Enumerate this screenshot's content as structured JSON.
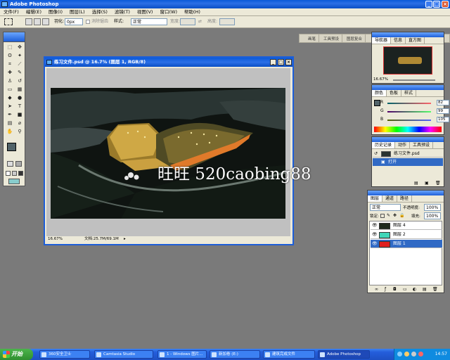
{
  "app": {
    "title": "Adobe Photoshop"
  },
  "menu": [
    "文件(F)",
    "编辑(E)",
    "图像(I)",
    "图层(L)",
    "选择(S)",
    "滤镜(T)",
    "视图(V)",
    "窗口(W)",
    "帮助(H)"
  ],
  "options": {
    "feather_label": "羽化:",
    "feather_value": "0px",
    "antialias_label": "消除锯齿",
    "style_label": "样式:",
    "style_value": "正常",
    "width_label": "宽度:",
    "height_label": "高度:"
  },
  "palette_well": [
    "画笔",
    "工具预设",
    "图层复合"
  ],
  "document": {
    "title": "练习文件.psd @ 16.7% (图层 1, RGB/8)",
    "zoom": "16.67%",
    "doc_info": "文档:25.7M/69.1M"
  },
  "navigator": {
    "tabs": [
      "导航器",
      "信息",
      "直方图"
    ],
    "zoom": "16.67%"
  },
  "color_panel": {
    "tabs": [
      "颜色",
      "色板",
      "样式"
    ],
    "r_label": "R",
    "r_value": "82",
    "g_label": "G",
    "g_value": "99",
    "b_label": "B",
    "b_value": "105"
  },
  "history": {
    "tabs": [
      "历史记录",
      "动作",
      "工具预设"
    ],
    "items": [
      "练习文件.psd",
      "打开"
    ]
  },
  "layers": {
    "tabs": [
      "图层",
      "通道",
      "路径"
    ],
    "blend_mode": "正常",
    "opacity_label": "不透明度:",
    "opacity": "100%",
    "lock_label": "锁定:",
    "fill_label": "填充:",
    "fill": "100%",
    "items": [
      {
        "name": "图层 4",
        "color": "#1e2a1e"
      },
      {
        "name": "图层 2",
        "color": "#3ed6b8"
      },
      {
        "name": "图层 1",
        "color": "#e02020"
      }
    ]
  },
  "watermark": "旺旺 520caobing88",
  "taskbar": {
    "start": "开始",
    "tasks": [
      "360安全卫士",
      "Camtasia Studio",
      "1 - Windows 图片...",
      "新加卷 (E:)",
      "建筑完成文件",
      "Adobe Photoshop"
    ],
    "clock": "14:57"
  },
  "colors": {
    "xp_blue": "#245edb",
    "panel_bg": "#ece9d8",
    "desktop": "#7a7a7a"
  }
}
